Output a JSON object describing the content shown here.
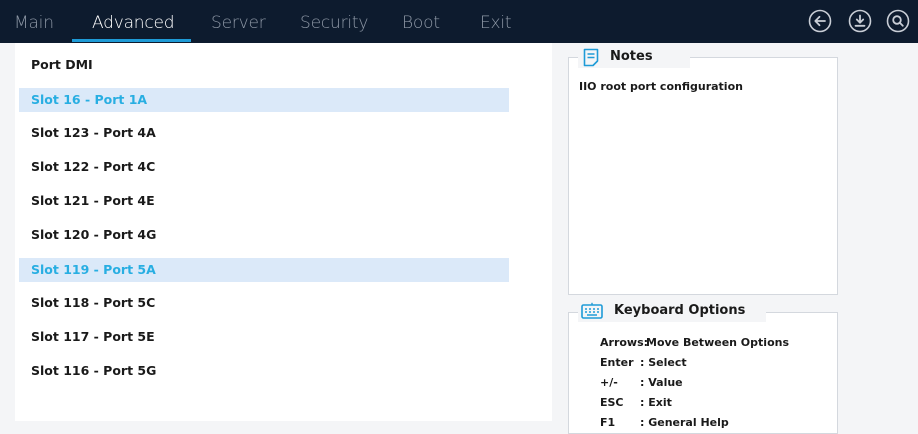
{
  "tabs": [
    {
      "label": "Main",
      "active": false
    },
    {
      "label": "Advanced",
      "active": true
    },
    {
      "label": "Server",
      "active": false
    },
    {
      "label": "Security",
      "active": false
    },
    {
      "label": "Boot",
      "active": false
    },
    {
      "label": "Exit",
      "active": false
    }
  ],
  "top_icons": [
    "back-arrow-icon",
    "download-icon",
    "search-icon"
  ],
  "accent_color": "#1e9bd7",
  "highlight_text_color": "#28aee2",
  "items": [
    {
      "label": "Port DMI",
      "highlighted": false
    },
    {
      "label": "Slot 16 - Port 1A",
      "highlighted": true
    },
    {
      "label": "Slot 123 - Port 4A",
      "highlighted": false
    },
    {
      "label": "Slot 122 - Port 4C",
      "highlighted": false
    },
    {
      "label": "Slot 121 - Port 4E",
      "highlighted": false
    },
    {
      "label": "Slot 120 - Port 4G",
      "highlighted": false
    },
    {
      "label": "Slot 119 - Port 5A",
      "highlighted": true
    },
    {
      "label": "Slot 118 - Port 5C",
      "highlighted": false
    },
    {
      "label": "Slot 117 - Port 5E",
      "highlighted": false
    },
    {
      "label": "Slot 116 - Port 5G",
      "highlighted": false
    }
  ],
  "notes": {
    "title": "Notes",
    "icon": "notes-icon",
    "text": "IIO root port configuration"
  },
  "keyboard": {
    "title": "Keyboard Options",
    "icon": "keyboard-icon",
    "rows": [
      {
        "key": "Arrows:",
        "desc": "Move Between Options"
      },
      {
        "key": "Enter",
        "desc": ": Select"
      },
      {
        "key": "+/-",
        "desc": ": Value"
      },
      {
        "key": "ESC",
        "desc": ": Exit"
      },
      {
        "key": "F1",
        "desc": ": General Help"
      }
    ]
  }
}
